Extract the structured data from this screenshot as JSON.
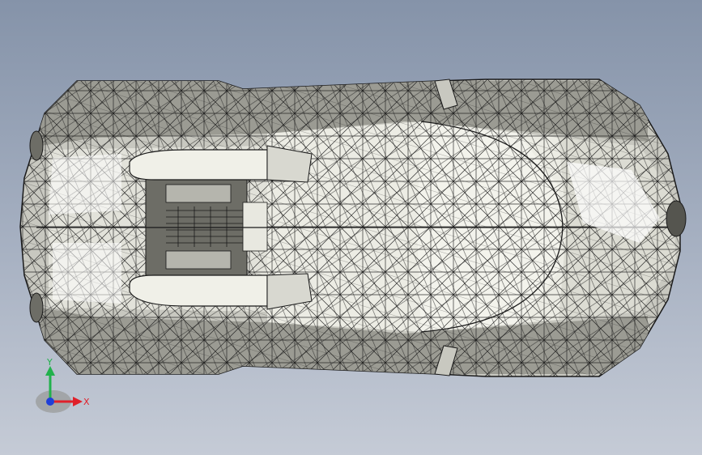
{
  "viewport": {
    "background_top": "#8593a9",
    "background_bottom": "#c5cbd6",
    "model": {
      "name": "car-body-mesh",
      "render_style": "shaded with edges (triangulated mesh)",
      "view": "top",
      "body_color": "#e8e8e0",
      "edge_color": "#1a1a1a",
      "shadow_color": "#4a4a44"
    }
  },
  "triad": {
    "x_label": "X",
    "y_label": "Y",
    "x_color": "#e0202a",
    "y_color": "#22b14c",
    "z_color": "#1f3fd8"
  }
}
